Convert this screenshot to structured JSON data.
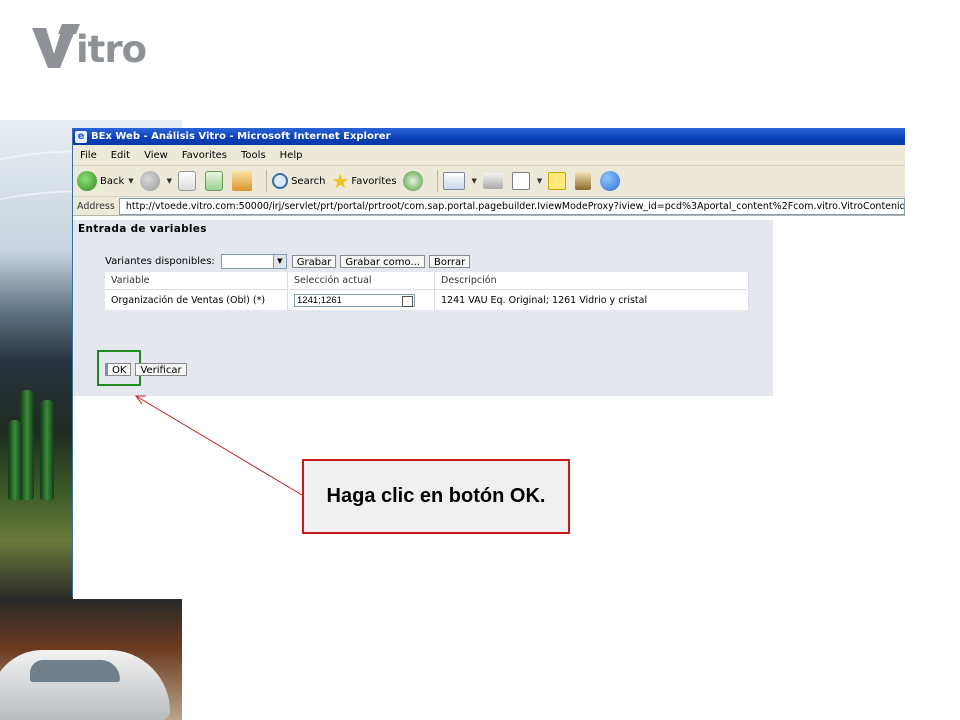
{
  "logo": {
    "text": "itro"
  },
  "browser": {
    "title": "BEx Web - Análisis Vitro - Microsoft Internet Explorer",
    "menu": [
      "File",
      "Edit",
      "View",
      "Favorites",
      "Tools",
      "Help"
    ],
    "toolbar": {
      "back": "Back",
      "search": "Search",
      "favorites": "Favorites"
    },
    "address": {
      "label": "Address",
      "url": "http://vtoede.vitro.com:50000/irj/servlet/prt/portal/prtroot/com.sap.portal.pagebuilder.IviewModeProxy?iview_id=pcd%3Aportal_content%2Fcom.vitro.VitroContenido%2Fcom"
    }
  },
  "page": {
    "title": "Entrada de variables",
    "variants_label": "Variantes disponibles:",
    "buttons": {
      "save": "Grabar",
      "save_as": "Grabar como...",
      "delete": "Borrar"
    },
    "table": {
      "headers": [
        "Variable",
        "Selección actual",
        "Descripción"
      ],
      "rows": [
        {
          "variable": "Organización de Ventas (Obl) (*)",
          "selection": "1241;1261",
          "description": "1241 VAU Eq. Original; 1261 Vidrio y cristal"
        }
      ]
    },
    "actions": {
      "ok": "OK",
      "verify": "Verificar"
    }
  },
  "callout": {
    "text": "Haga clic en botón OK."
  },
  "colors": {
    "highlight": "#1f8a1f",
    "callout_border": "#cc1b1b",
    "arrow": "#cc1b1b"
  }
}
